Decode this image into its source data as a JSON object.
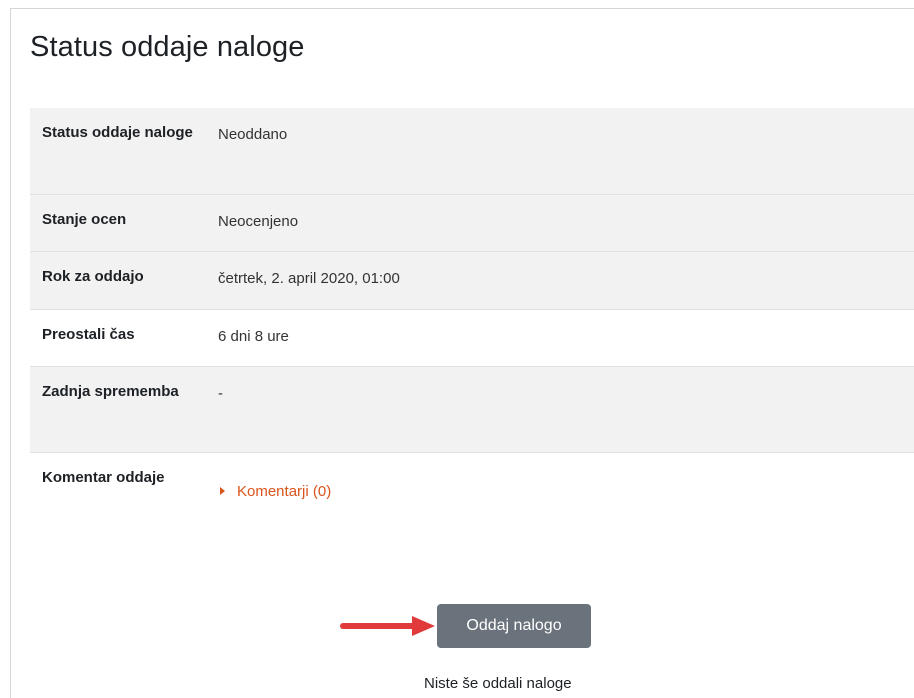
{
  "page": {
    "title": "Status oddaje naloge"
  },
  "status_table": {
    "rows": [
      {
        "label": "Status oddaje naloge",
        "value": "Neoddano"
      },
      {
        "label": "Stanje ocen",
        "value": "Neocenjeno"
      },
      {
        "label": "Rok za oddajo",
        "value": "četrtek, 2. april 2020, 01:00"
      },
      {
        "label": "Preostali čas",
        "value": "6 dni 8 ure"
      },
      {
        "label": "Zadnja sprememba",
        "value": "-"
      },
      {
        "label": "Komentar oddaje",
        "value": "Komentarji (0)"
      }
    ]
  },
  "actions": {
    "submit_label": "Oddaj nalogo",
    "note": "Niste še oddali naloge"
  },
  "colors": {
    "link": "#d9541b",
    "button": "#6a737b",
    "arrow": "#e03a3a",
    "shaded_row": "#f2f2f2"
  },
  "icons": {
    "comment_toggle": "caret-right-icon",
    "annotation": "red-arrow-icon"
  }
}
